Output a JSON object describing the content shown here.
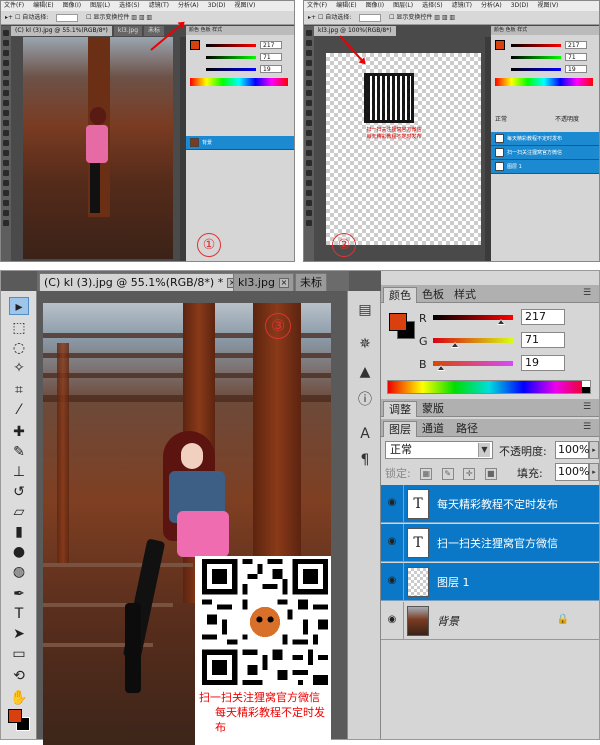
{
  "top_left": {
    "number_badge": "①",
    "tabs": [
      "(C) kl (3).jpg @ 55.1%(RGB/8*)",
      "kl3.jpg",
      "未标"
    ],
    "color_values": [
      "217",
      "71",
      "19"
    ],
    "layers": [
      "背景"
    ]
  },
  "top_right": {
    "number_badge": "②",
    "tab": "kl3.jpg @ 100%(RGB/8*)",
    "color_values": [
      "217",
      "71",
      "19"
    ],
    "qr_caption": [
      "扫一扫关注狸窝官方微信",
      "每天精彩教程不定时发布"
    ],
    "blend_mode": "正常",
    "opacity_label": "不透明度",
    "layers": [
      "每天精彩教程不定时发布",
      "扫一扫关注狸窝官方微信",
      "图层 1"
    ]
  },
  "main": {
    "number_badge": "③",
    "tabs": [
      {
        "label": "(C) kl (3).jpg @ 55.1%(RGB/8*) *",
        "close": "×"
      },
      {
        "label": "kl3.jpg",
        "close": "×"
      },
      {
        "label": "未标"
      }
    ],
    "qr_caption": {
      "line1": "扫一扫关注狸窝官方微信",
      "line2": "每天精彩教程不定时发布"
    }
  },
  "colors": {
    "tabs": [
      "颜色",
      "色板",
      "样式"
    ],
    "channels": [
      {
        "label": "R",
        "value": "217"
      },
      {
        "label": "G",
        "value": "71"
      },
      {
        "label": "B",
        "value": "19"
      }
    ],
    "foreground": "#d9400f",
    "background": "#000000"
  },
  "adjust_tabs": [
    "调整",
    "蒙版"
  ],
  "layers_panel": {
    "tabs": [
      "图层",
      "通道",
      "路径"
    ],
    "blend_mode": "正常",
    "opacity_label": "不透明度:",
    "opacity_value": "100%",
    "lock_label": "锁定:",
    "fill_label": "填充:",
    "fill_value": "100%",
    "layers": [
      {
        "name": "每天精彩教程不定时发布",
        "type": "text",
        "thumb": "T",
        "selected": true
      },
      {
        "name": "扫一扫关注狸窝官方微信",
        "type": "text",
        "thumb": "T",
        "selected": true
      },
      {
        "name": "图层 1",
        "type": "image",
        "thumb": "",
        "selected": true
      },
      {
        "name": "背景",
        "type": "background",
        "thumb": "",
        "selected": false
      }
    ]
  },
  "accent_colors": {
    "selection": "#0a78c6",
    "annotation": "#dd0000"
  }
}
